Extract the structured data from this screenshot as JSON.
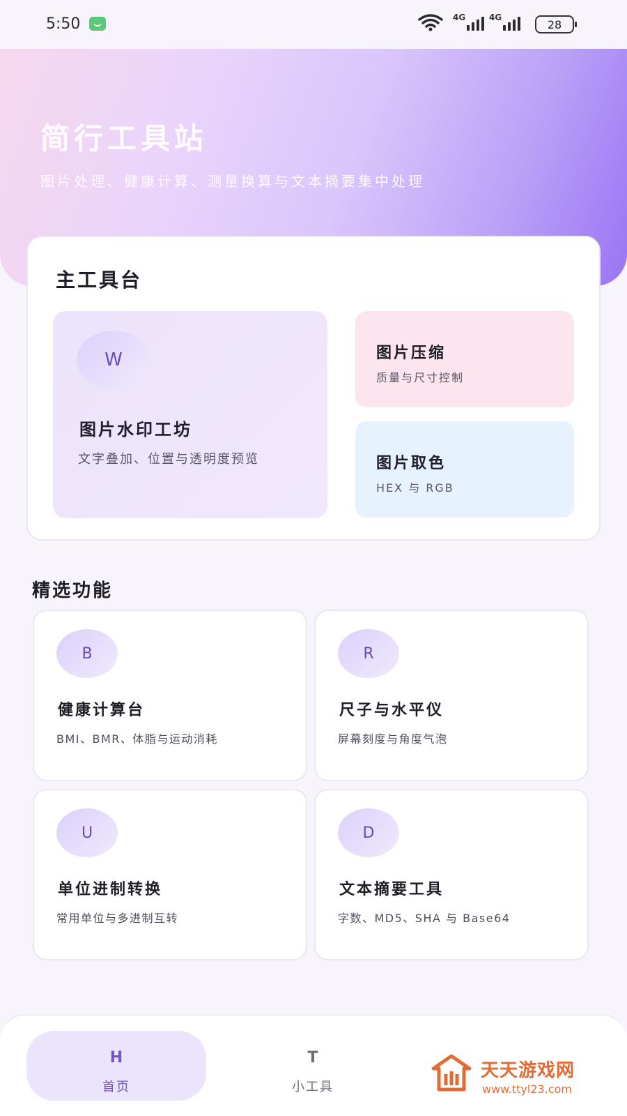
{
  "status_bar": {
    "time": "5:50",
    "signal_1": "4G",
    "signal_2": "4G",
    "battery": "28"
  },
  "hero": {
    "title": "简行工具站",
    "subtitle": "图片处理、健康计算、测量换算与文本摘要集中处理"
  },
  "main_panel": {
    "title": "主工具台",
    "primary": {
      "icon_letter": "W",
      "title": "图片水印工坊",
      "desc": "文字叠加、位置与透明度预览"
    },
    "compress": {
      "title": "图片压缩",
      "desc": "质量与尺寸控制"
    },
    "color": {
      "title": "图片取色",
      "desc": "HEX 与 RGB"
    }
  },
  "featured": {
    "title": "精选功能",
    "items": [
      {
        "letter": "B",
        "title": "健康计算台",
        "desc": "BMI、BMR、体脂与运动消耗"
      },
      {
        "letter": "R",
        "title": "尺子与水平仪",
        "desc": "屏幕刻度与角度气泡"
      },
      {
        "letter": "U",
        "title": "单位进制转换",
        "desc": "常用单位与多进制互转"
      },
      {
        "letter": "D",
        "title": "文本摘要工具",
        "desc": "字数、MD5、SHA 与 Base64"
      }
    ]
  },
  "bottom_nav": {
    "items": [
      {
        "icon": "H",
        "label": "首页"
      },
      {
        "icon": "T",
        "label": "小工具"
      }
    ]
  },
  "watermark": {
    "name": "天天游戏网",
    "url": "www.ttyl23.com"
  },
  "colors": {
    "accent": "#7254c4",
    "hero_end": "#9a74f4",
    "compress_bg": "#fde5ef",
    "color_bg": "#e6f2fd"
  }
}
